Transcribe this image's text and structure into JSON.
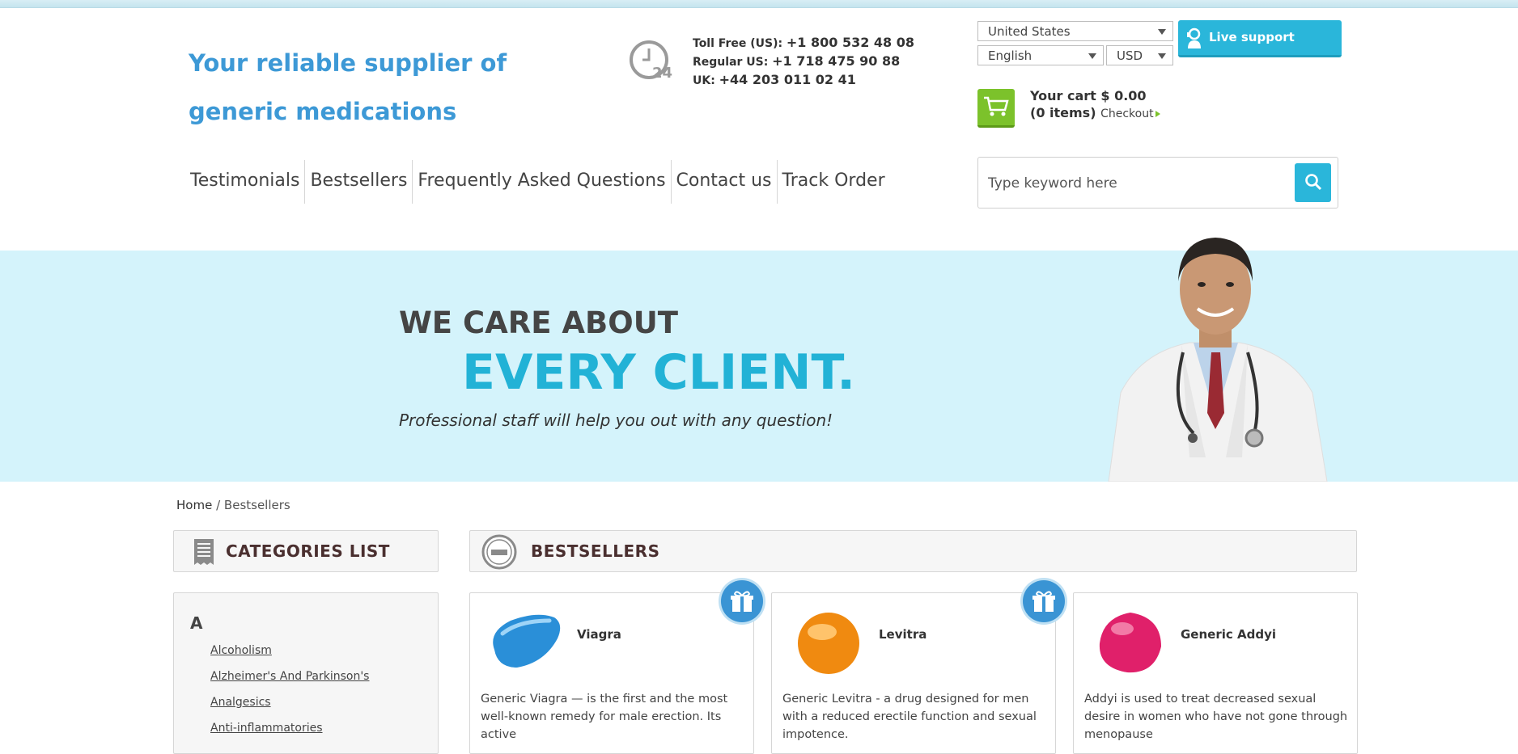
{
  "header": {
    "tagline": "Your reliable supplier of generic medications",
    "phones": [
      {
        "label": "Toll Free (US):",
        "number": "+1 800 532 48 08"
      },
      {
        "label": "Regular US:",
        "number": "+1 718 475 90 88"
      },
      {
        "label": "UK:",
        "number": "+44 203 011 02 41"
      }
    ],
    "country": "United States",
    "language": "English",
    "currency": "USD",
    "live_support": "Live support",
    "cart": {
      "label": "Your cart",
      "amount": "$ 0.00",
      "items": "(0 items)",
      "checkout": "Checkout"
    },
    "nav": [
      "Testimonials",
      "Bestsellers",
      "Frequently Asked Questions",
      "Contact us",
      "Track Order"
    ],
    "search_placeholder": "Type keyword here"
  },
  "hero": {
    "line1": "WE CARE ABOUT",
    "line2": "EVERY CLIENT.",
    "line3": "Professional staff will help you out with any question!"
  },
  "breadcrumb": {
    "home": "Home",
    "separator": "/",
    "current": "Bestsellers"
  },
  "categories": {
    "title": "CATEGORIES LIST",
    "letter": "A",
    "items": [
      "Alcoholism",
      "Alzheimer's And Parkinson's",
      "Analgesics",
      "Anti-inflammatories"
    ]
  },
  "bestsellers": {
    "title": "BESTSELLERS",
    "products": [
      {
        "name": "Viagra",
        "desc": "Generic Viagra — is the first and the most well-known remedy for male erection. Its active",
        "pill_color": "#2a8fd8"
      },
      {
        "name": "Levitra",
        "desc": "Generic Levitra - a drug designed for men with a reduced erectile function and sexual impotence.",
        "pill_color": "#f08a10"
      },
      {
        "name": "Generic Addyi",
        "desc": "Addyi is used to treat decreased sexual desire in women who have not gone through menopause",
        "pill_color": "#e0206a"
      }
    ]
  },
  "colors": {
    "accent": "#2ab6da",
    "tagline": "#3d99d6",
    "hero_bg": "#d4f3fb",
    "cart_green": "#7cc22b"
  }
}
